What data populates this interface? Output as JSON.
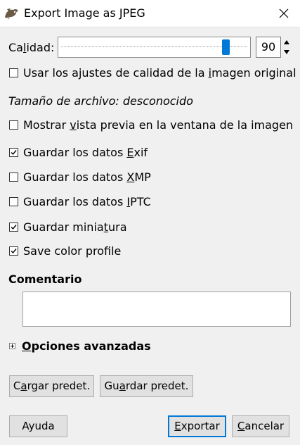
{
  "window": {
    "title": "Export Image as JPEG"
  },
  "quality": {
    "label_pre": "Ca",
    "label_mnemonic": "l",
    "label_post": "idad:",
    "value": "90",
    "slider_fraction": 0.9
  },
  "checks": {
    "original_quality": {
      "pre": "Usar los ajustes de calidad de la ",
      "mnemonic": "i",
      "post": "magen original",
      "checked": false
    },
    "filesize": "Tamaño de archivo: desconocido",
    "preview": {
      "pre": "Mostrar ",
      "mnemonic": "v",
      "post": "ista previa en la ventana de la imagen",
      "checked": false
    },
    "exif": {
      "pre": "Guardar los datos ",
      "mnemonic": "E",
      "post": "xif",
      "checked": true
    },
    "xmp": {
      "pre": "Guardar los datos ",
      "mnemonic": "X",
      "post": "MP",
      "checked": false
    },
    "iptc": {
      "pre": "Guardar los datos ",
      "mnemonic": "I",
      "post": "PTC",
      "checked": false
    },
    "thumbnail": {
      "pre": "Guardar minia",
      "mnemonic": "t",
      "post": "ura",
      "checked": true
    },
    "color_profile": {
      "pre": "Save color profile",
      "mnemonic": "",
      "post": "",
      "checked": true
    }
  },
  "comment": {
    "heading": "Comentario",
    "value": ""
  },
  "advanced": {
    "mnemonic": "O",
    "post": "pciones avanzadas"
  },
  "buttons": {
    "load_defaults": {
      "pre": "C",
      "mnemonic": "a",
      "post": "rgar predet."
    },
    "save_defaults": {
      "pre": "Gu",
      "mnemonic": "a",
      "post": "rdar predet."
    },
    "help": {
      "pre": "Ayuda",
      "mnemonic": "",
      "post": ""
    },
    "export": {
      "pre": "",
      "mnemonic": "E",
      "post": "xportar"
    },
    "cancel": {
      "pre": "",
      "mnemonic": "C",
      "post": "ancelar"
    }
  },
  "colors": {
    "accent": "#0078d7",
    "background": "#f0f0f0"
  },
  "icons": {
    "app": "gimp-wilber-icon",
    "close": "close-icon",
    "check": "checkmark-icon",
    "expander": "expander-plus-icon"
  }
}
